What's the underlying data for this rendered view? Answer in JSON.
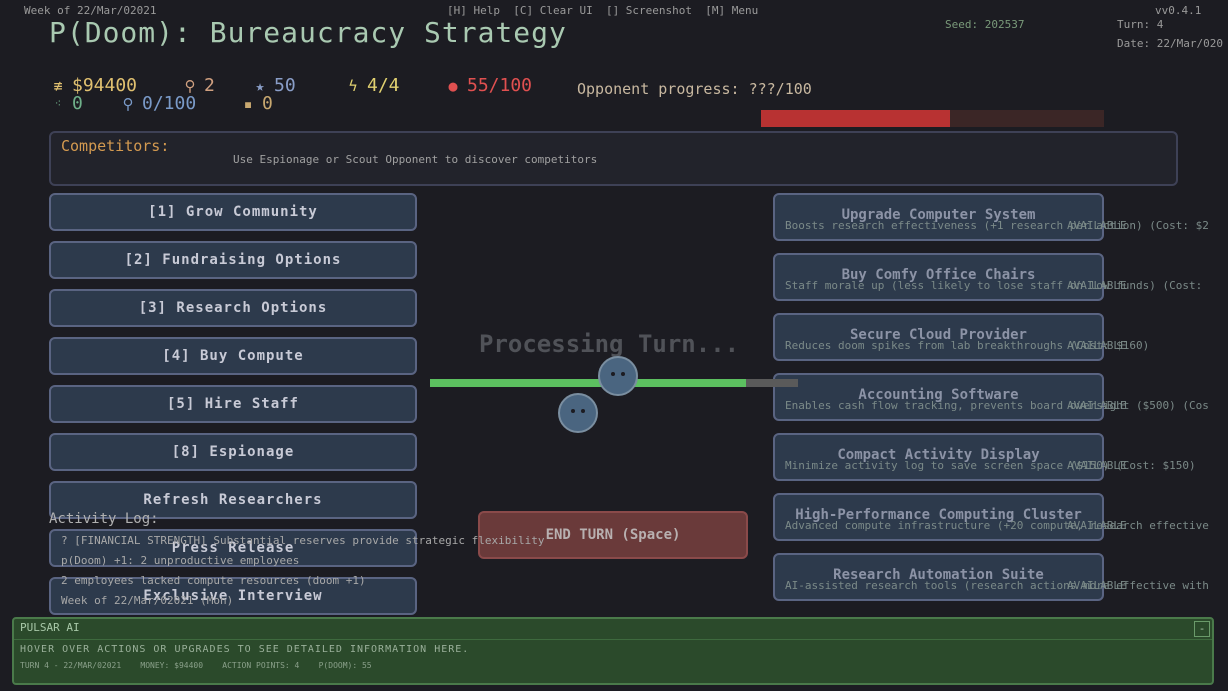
{
  "topbar": {
    "week": "Week of 22/Mar/02021",
    "shortcuts": "[H] Help  [C] Clear UI  [] Screenshot  [M] Menu",
    "version": "vv0.4.1",
    "seed": "Seed: 202537",
    "turn": "Turn: 4",
    "date": "Date: 22/Mar/020"
  },
  "title": "P(Doom): Bureaucracy Strategy",
  "stats": {
    "money": "$94400",
    "staff": "2",
    "reputation": "50",
    "action_points": "4/4",
    "doom": "55/100",
    "opponent_progress": "Opponent progress: ???/100",
    "row2_a": "0",
    "row2_b": "0/100",
    "row2_c": "0"
  },
  "opponent_bar": {
    "fraction": 0.55,
    "fill_color": "#b83232",
    "track_color": "#3b2626"
  },
  "competitors": {
    "label": "Competitors:",
    "hint": "Use Espionage or Scout Opponent to discover competitors"
  },
  "actions": [
    {
      "label": "[1] Grow Community"
    },
    {
      "label": "[2] Fundraising Options"
    },
    {
      "label": "[3] Research Options"
    },
    {
      "label": "[4] Buy Compute"
    },
    {
      "label": "[5] Hire Staff"
    },
    {
      "label": "[8] Espionage"
    },
    {
      "label": "Refresh Researchers"
    },
    {
      "label": "Press Release"
    },
    {
      "label": "Exclusive Interview"
    }
  ],
  "upgrades": [
    {
      "name": "Upgrade Computer System",
      "desc": "Boosts research effectiveness (+1 research per action) (Cost: $2",
      "status": "AVAILABLE"
    },
    {
      "name": "Buy Comfy Office Chairs",
      "desc": "Staff morale up (less likely to lose staff on low funds) (Cost:",
      "status": "AVAILABLE"
    },
    {
      "name": "Secure Cloud Provider",
      "desc": "Reduces doom spikes from lab breakthroughs (Cost: $160)",
      "status": "AVAILABLE"
    },
    {
      "name": "Accounting Software",
      "desc": "Enables cash flow tracking, prevents board oversight ($500) (Cos",
      "status": "AVAILABLE"
    },
    {
      "name": "Compact Activity Display",
      "desc": "Minimize activity log to save screen space ($150) (Cost: $150)",
      "status": "AVAILABLE"
    },
    {
      "name": "High-Performance Computing Cluster",
      "desc": "Advanced compute infrastructure (+20 compute, research effective",
      "status": "AVAILABLE"
    },
    {
      "name": "Research Automation Suite",
      "desc": "AI-assisted research tools (research actions more effective with",
      "status": "AVAILABLE"
    }
  ],
  "processing": {
    "text": "Processing Turn...",
    "progress": 0.86
  },
  "end_turn": "END TURN (Space)",
  "activity": {
    "label": "Activity Log:",
    "entries": [
      "? [FINANCIAL STRENGTH] Substantial reserves provide strategic flexibility",
      "p(Doom) +1: 2 unproductive employees",
      "2 employees lacked compute resources (doom +1)",
      "Week of 22/Mar/02021 (Mon)"
    ]
  },
  "assistant": {
    "name": "PULSAR AI",
    "minimize": "-",
    "message": "HOVER OVER ACTIONS OR UPGRADES TO SEE DETAILED INFORMATION HERE.",
    "status": "TURN 4 - 22/MAR/02021    MONEY: $94400    ACTION POINTS: 4    P(DOOM): 55"
  }
}
